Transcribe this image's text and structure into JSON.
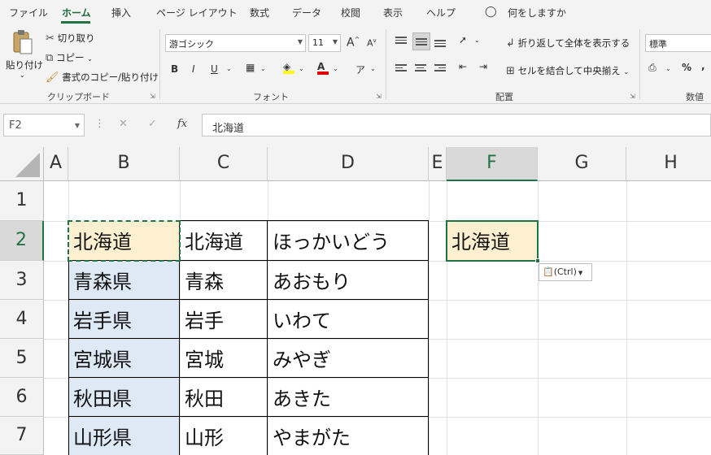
{
  "ribbon_tabs": [
    "ファイル",
    "ホーム",
    "挿入",
    "ページ レイアウト",
    "数式",
    "データ",
    "校閲",
    "表示",
    "ヘルプ"
  ],
  "tell_me": "何をしますか",
  "clipboard": {
    "paste_label": "貼り付け",
    "cut_label": "切り取り",
    "copy_label": "コピー",
    "format_painter_label": "書式のコピー/貼り付け",
    "group_label": "クリップボード"
  },
  "font": {
    "name": "游ゴシック",
    "size": "11",
    "grow": "A",
    "shrink": "A",
    "bold": "B",
    "italic": "I",
    "underline": "U",
    "color_letter": "A",
    "group_label": "フォント"
  },
  "alignment": {
    "wrap_label": "折り返して全体を表示する",
    "merge_label": "セルを結合して中央揃え",
    "group_label": "配置"
  },
  "number": {
    "format": "標準",
    "percent": "%",
    "comma": ",",
    "group_label": "数値"
  },
  "formula_bar": {
    "name_box": "F2",
    "fx": "fx",
    "content": "北海道"
  },
  "columns": [
    "A",
    "B",
    "C",
    "D",
    "E",
    "F",
    "G",
    "H"
  ],
  "rows": [
    "1",
    "2",
    "3",
    "4",
    "5",
    "6",
    "7"
  ],
  "table": [
    [
      "北海道",
      "北海道",
      "ほっかいどう"
    ],
    [
      "青森県",
      "青森",
      "あおもり"
    ],
    [
      "岩手県",
      "岩手",
      "いわて"
    ],
    [
      "宮城県",
      "宮城",
      "みやぎ"
    ],
    [
      "秋田県",
      "秋田",
      "あきた"
    ],
    [
      "山形県",
      "山形",
      "やまがた"
    ]
  ],
  "f2_value": "北海道",
  "paste_options": "(Ctrl)",
  "colors": {
    "accent": "#217346",
    "cell_highlight": "#fdf0d0",
    "column_b_fill": "#dde9f5"
  }
}
